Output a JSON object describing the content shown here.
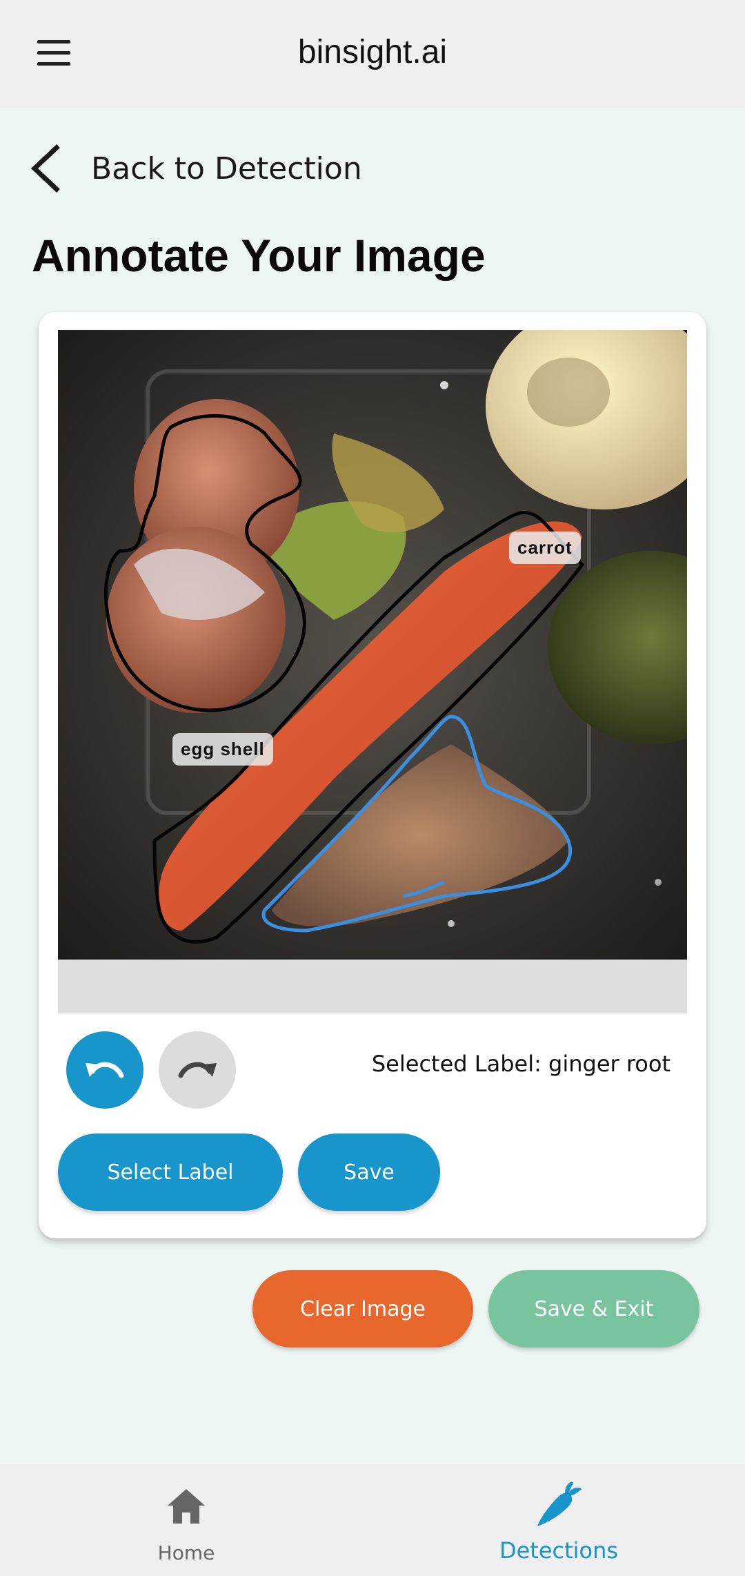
{
  "app_bar": {
    "title": "binsight.ai",
    "menu_icon": "hamburger-menu-icon"
  },
  "back": {
    "label": "Back to Detection",
    "icon": "chevron-left-icon"
  },
  "page": {
    "title": "Annotate Your Image"
  },
  "annotations": [
    {
      "label": "carrot"
    },
    {
      "label": "egg shell"
    }
  ],
  "controls": {
    "undo_icon": "undo-icon",
    "redo_icon": "redo-icon",
    "selected_label": "Selected Label: ginger root",
    "select_label_button": "Select Label",
    "save_button": "Save"
  },
  "actions": {
    "clear_button": "Clear Image",
    "save_exit_button": "Save & Exit"
  },
  "bottom_nav": {
    "items": [
      {
        "label": "Home",
        "icon": "home-icon",
        "active": false
      },
      {
        "label": "Detections",
        "icon": "carrot-icon",
        "active": true
      }
    ]
  },
  "colors": {
    "primary": "#1895cb",
    "danger": "#e8672c",
    "success": "#77c49f",
    "annotation_active": "#3a8fe0",
    "annotation_saved": "#000000"
  }
}
